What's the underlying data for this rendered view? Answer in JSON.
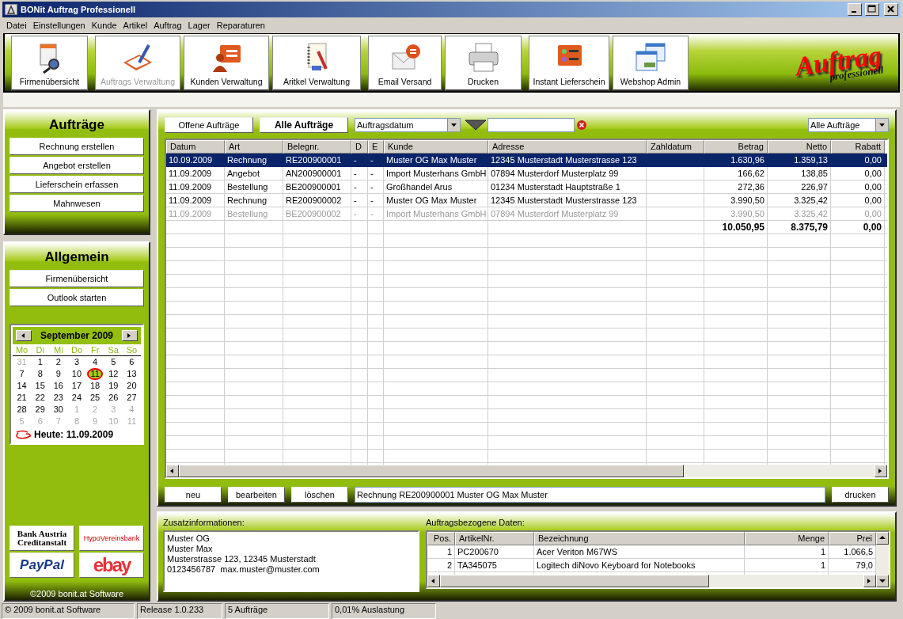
{
  "window": {
    "title": "BONit Auftrag Professionell"
  },
  "menu": [
    "Datei",
    "Einstellungen",
    "Kunde",
    "Artikel",
    "Auftrag",
    "Lager",
    "Reparaturen"
  ],
  "toolbar": [
    {
      "label": "Firmenübersicht",
      "kind": "overview",
      "disabled": false
    },
    {
      "label": "Auftrags Verwaltung",
      "kind": "edit",
      "disabled": true
    },
    {
      "label": "Kunden Verwaltung",
      "kind": "person",
      "disabled": false
    },
    {
      "label": "Aritkel Verwaltung",
      "kind": "notebook",
      "disabled": false
    },
    {
      "label": "Email Versand",
      "kind": "mail",
      "disabled": false
    },
    {
      "label": "Drucken",
      "kind": "printer",
      "disabled": false
    },
    {
      "label": "Instant Lieferschein",
      "kind": "list",
      "disabled": false
    },
    {
      "label": "Webshop Admin",
      "kind": "windows",
      "disabled": false
    }
  ],
  "logo": {
    "title": "Auftrag",
    "subtitle": "professionell"
  },
  "sidebar": {
    "orders_panel": {
      "title": "Aufträge",
      "buttons": [
        "Rechnung erstellen",
        "Angebot erstellen",
        "Lieferschein erfassen",
        "Mahnwesen"
      ]
    },
    "general_panel": {
      "title": "Allgemein",
      "buttons": [
        "Firmenübersicht",
        "Outlook starten"
      ]
    },
    "calendar": {
      "month": "September 2009",
      "weekdays": [
        "Mo",
        "Di",
        "Mi",
        "Do",
        "Fr",
        "Sa",
        "So"
      ],
      "weeks": [
        [
          {
            "day": "31",
            "other_month": true,
            "today": false
          },
          {
            "day": "1",
            "other_month": false,
            "today": false
          },
          {
            "day": "2",
            "other_month": false,
            "today": false
          },
          {
            "day": "3",
            "other_month": false,
            "today": false
          },
          {
            "day": "4",
            "other_month": false,
            "today": false
          },
          {
            "day": "5",
            "other_month": false,
            "today": false
          },
          {
            "day": "6",
            "other_month": false,
            "today": false
          }
        ],
        [
          {
            "day": "7",
            "other_month": false,
            "today": false
          },
          {
            "day": "8",
            "other_month": false,
            "today": false
          },
          {
            "day": "9",
            "other_month": false,
            "today": false
          },
          {
            "day": "10",
            "other_month": false,
            "today": false
          },
          {
            "day": "11",
            "other_month": false,
            "today": true
          },
          {
            "day": "12",
            "other_month": false,
            "today": false
          },
          {
            "day": "13",
            "other_month": false,
            "today": false
          }
        ],
        [
          {
            "day": "14",
            "other_month": false,
            "today": false
          },
          {
            "day": "15",
            "other_month": false,
            "today": false
          },
          {
            "day": "16",
            "other_month": false,
            "today": false
          },
          {
            "day": "17",
            "other_month": false,
            "today": false
          },
          {
            "day": "18",
            "other_month": false,
            "today": false
          },
          {
            "day": "19",
            "other_month": false,
            "today": false
          },
          {
            "day": "20",
            "other_month": false,
            "today": false
          }
        ],
        [
          {
            "day": "21",
            "other_month": false,
            "today": false
          },
          {
            "day": "22",
            "other_month": false,
            "today": false
          },
          {
            "day": "23",
            "other_month": false,
            "today": false
          },
          {
            "day": "24",
            "other_month": false,
            "today": false
          },
          {
            "day": "25",
            "other_month": false,
            "today": false
          },
          {
            "day": "26",
            "other_month": false,
            "today": false
          },
          {
            "day": "27",
            "other_month": false,
            "today": false
          }
        ],
        [
          {
            "day": "28",
            "other_month": false,
            "today": false
          },
          {
            "day": "29",
            "other_month": false,
            "today": false
          },
          {
            "day": "30",
            "other_month": false,
            "today": false
          },
          {
            "day": "1",
            "other_month": true,
            "today": false
          },
          {
            "day": "2",
            "other_month": true,
            "today": false
          },
          {
            "day": "3",
            "other_month": true,
            "today": false
          },
          {
            "day": "4",
            "other_month": true,
            "today": false
          }
        ],
        [
          {
            "day": "5",
            "other_month": true,
            "today": false
          },
          {
            "day": "6",
            "other_month": true,
            "today": false
          },
          {
            "day": "7",
            "other_month": true,
            "today": false
          },
          {
            "day": "8",
            "other_month": true,
            "today": false
          },
          {
            "day": "9",
            "other_month": true,
            "today": false
          },
          {
            "day": "10",
            "other_month": true,
            "today": false
          },
          {
            "day": "11",
            "other_month": true,
            "today": false
          }
        ]
      ],
      "today_label": "Heute: 11.09.2009"
    },
    "partner_logos": [
      {
        "kind": "bank_austria",
        "lines": [
          "Bank Austria",
          "Creditanstalt"
        ]
      },
      {
        "kind": "hypo",
        "lines": [
          "HypoVereinsbank"
        ]
      },
      {
        "kind": "paypal",
        "lines": [
          "PayPal"
        ]
      },
      {
        "kind": "ebay",
        "lines": [
          "ebay"
        ]
      }
    ],
    "copyright": "©2009 bonit.at Software"
  },
  "orders": {
    "filters": [
      {
        "label": "Offene Aufträge",
        "selected": false
      },
      {
        "label": "Alle Aufträge",
        "selected": true
      }
    ],
    "date_field": {
      "value": "Auftragsdatum"
    },
    "view_select": {
      "value": "Alle Aufträge"
    },
    "table": {
      "columns": [
        "Datum",
        "Art",
        "Belegnr.",
        "D",
        "E",
        "Kunde",
        "Adresse",
        "Zahldatum",
        "Betrag",
        "Netto",
        "Rabatt"
      ],
      "rows": [
        {
          "selected": true,
          "disabled": false,
          "cells": [
            "10.09.2009",
            "Rechnung",
            "RE200900001",
            "-",
            "-",
            "Muster OG Max Muster",
            "12345 Musterstadt Musterstrasse 123",
            "",
            "1.630,96",
            "1.359,13",
            "0,00"
          ]
        },
        {
          "selected": false,
          "disabled": false,
          "cells": [
            "11.09.2009",
            "Angebot",
            "AN200900001",
            "-",
            "-",
            "Import Musterhans GmbH",
            "07894 Musterdorf Musterplatz 99",
            "",
            "166,62",
            "138,85",
            "0,00"
          ]
        },
        {
          "selected": false,
          "disabled": false,
          "cells": [
            "11.09.2009",
            "Bestellung",
            "BE200900001",
            "-",
            "-",
            "Großhandel Arus",
            "01234 Musterstadt Hauptstraße 1",
            "",
            "272,36",
            "226,97",
            "0,00"
          ]
        },
        {
          "selected": false,
          "disabled": false,
          "cells": [
            "11.09.2009",
            "Rechnung",
            "RE200900002",
            "-",
            "-",
            "Muster OG Max Muster",
            "12345 Musterstadt Musterstrasse 123",
            "",
            "3.990,50",
            "3.325,42",
            "0,00"
          ]
        },
        {
          "selected": false,
          "disabled": true,
          "cells": [
            "11.09.2009",
            "Bestellung",
            "BE200900002",
            "-",
            "-",
            "Import Musterhans GmbH",
            "07894 Musterdorf Musterplatz 99",
            "",
            "3.990,50",
            "3.325,42",
            "0,00"
          ]
        }
      ],
      "totals": [
        "10.050,95",
        "8.375,79",
        "0,00"
      ]
    },
    "actions": [
      "neu",
      "bearbeiten",
      "löschen"
    ],
    "summary": {
      "value": "Rechnung RE200900001 Muster OG Max Muster"
    },
    "print": "drucken"
  },
  "details": {
    "label": "Zusatzinformationen:",
    "lines": [
      "Muster OG",
      "Muster Max",
      "Musterstrasse 123, 12345 Musterstadt",
      "0123456787  max.muster@muster.com"
    ]
  },
  "items": {
    "label": "Auftragsbezogene Daten:",
    "columns": [
      "Pos.",
      "ArtikelNr.",
      "Bezeichnung",
      "Menge",
      "Prei"
    ],
    "rows": [
      [
        "1",
        "PC200670",
        "Acer Veriton M67WS",
        "1",
        "1.066,5"
      ],
      [
        "2",
        "TA345075",
        "Logitech diNovo Keyboard for Notebooks",
        "1",
        "79,0"
      ]
    ]
  },
  "status_bar": [
    "© 2009 bonit.at Software",
    "Release 1.0.233",
    "5 Aufträge",
    "0,01% Auslastung"
  ]
}
